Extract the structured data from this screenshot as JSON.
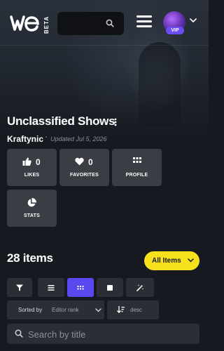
{
  "header": {
    "logo_text": "We",
    "beta_label": "BETA",
    "search_placeholder": "",
    "vip_label": "VIP"
  },
  "collection": {
    "title": "Unclassified Shows",
    "author": "Kraftynic",
    "updated": "Updated Jul 5, 2026"
  },
  "stats": {
    "likes_label": "LIKES",
    "likes_count": "0",
    "favorites_label": "FAVORITES",
    "favorites_count": "0",
    "profile_label": "PROFILE",
    "stats_label": "STATS"
  },
  "items": {
    "count_label": "28 items",
    "filter_label": "All Items"
  },
  "toolbar": {
    "active_view": "grid",
    "views": [
      "filter",
      "list",
      "grid",
      "large",
      "random"
    ]
  },
  "sort": {
    "label": "Sorted by",
    "value": "Editor rank",
    "order": "desc"
  },
  "search": {
    "placeholder": "Search by title"
  },
  "colors": {
    "background": "#16191f",
    "card": "#3a3d43",
    "accent_yellow": "#f6e11c",
    "accent_purple": "#5b49f0"
  }
}
